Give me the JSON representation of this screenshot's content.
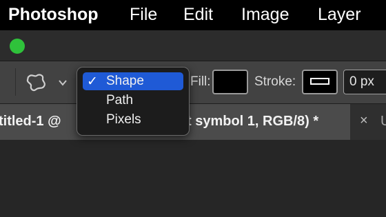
{
  "menubar": {
    "app": "Photoshop",
    "items": [
      "File",
      "Edit",
      "Image",
      "Layer"
    ]
  },
  "window": {
    "close_color": "#2fc23b"
  },
  "options_bar": {
    "tool_icon": "custom-shape-icon",
    "fill_label": "Fill:",
    "fill_color": "#000000",
    "stroke_label": "Stroke:",
    "stroke_width": "0 px"
  },
  "tool_mode_menu": {
    "items": [
      {
        "label": "Shape",
        "checked": true
      },
      {
        "label": "Path",
        "checked": false
      },
      {
        "label": "Pixels",
        "checked": false
      }
    ],
    "check_glyph": "✓",
    "highlight_color": "#1f5ad6"
  },
  "tabs": {
    "active_prefix": "titled-1 @",
    "active_suffix": "t symbol 1, RGB/8) *",
    "close_glyph": "×",
    "inactive_text": "U"
  }
}
